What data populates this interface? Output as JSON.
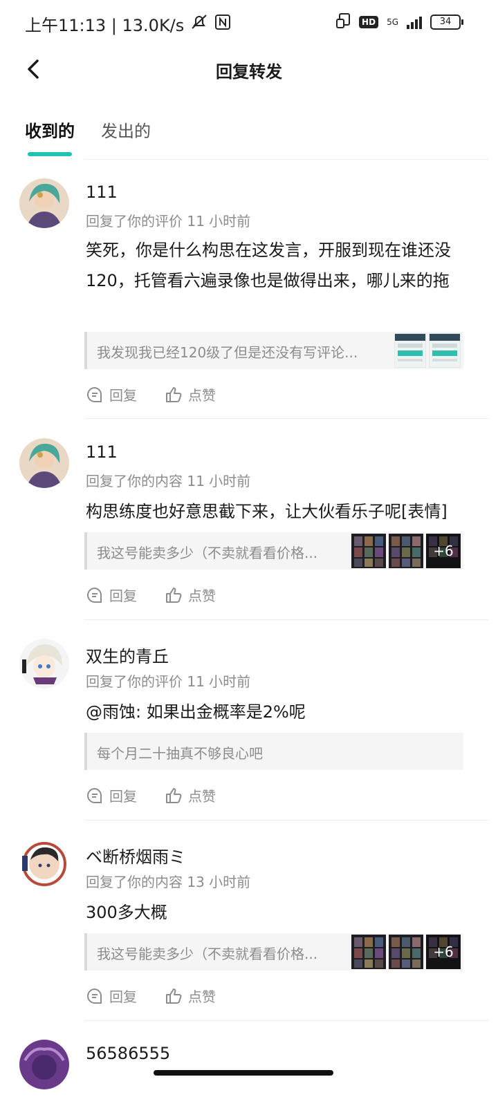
{
  "status_bar": {
    "time_speed": "上午11:13 | 13.0K/s",
    "network": "5G",
    "hd": "HD",
    "battery": "34"
  },
  "header": {
    "title": "回复转发"
  },
  "tabs": [
    {
      "label": "收到的",
      "active": true
    },
    {
      "label": "发出的",
      "active": false
    }
  ],
  "actions": {
    "reply": "回复",
    "like": "点赞"
  },
  "items": [
    {
      "username": "111",
      "meta": "回复了你的评价 11 小时前",
      "content": "笑死，你是什么构思在这发言，开服到现在谁还没120，托管看六遍录像也是做得出来，哪儿来的拖",
      "quote": "我发现我已经120级了但是还没有写评论..."
    },
    {
      "username": "111",
      "meta": "回复了你的内容 11 小时前",
      "content": "构思练度也好意思截下来，让大伙看乐子呢[表情]",
      "quote": "我这号能卖多少（不卖就看看价格...",
      "thumb_more": "+6"
    },
    {
      "username": "双生的青丘",
      "meta": "回复了你的评价 11 小时前",
      "content": "@雨蚀: 如果出金概率是2%呢",
      "quote": "每个月二十抽真不够良心吧"
    },
    {
      "username": "ベ断桥烟雨ミ",
      "meta": "回复了你的内容 13 小时前",
      "content": "300多大概",
      "quote": "我这号能卖多少（不卖就看看价格...",
      "thumb_more": "+6"
    },
    {
      "username": "56586555"
    }
  ]
}
